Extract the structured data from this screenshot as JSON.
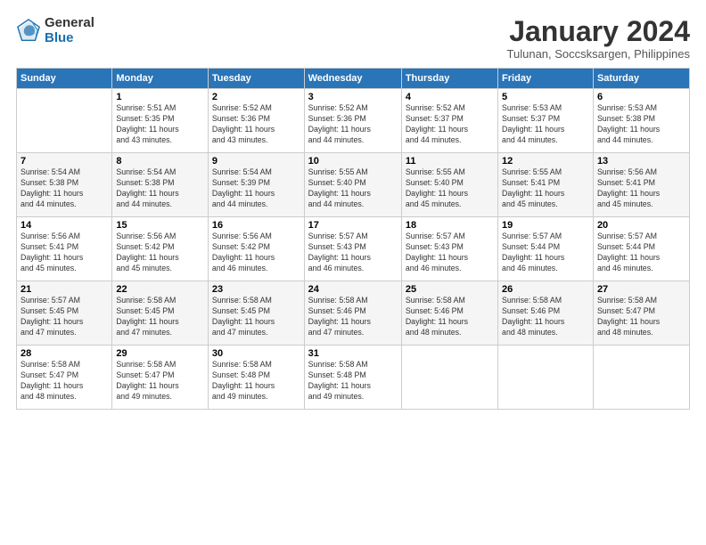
{
  "logo": {
    "general": "General",
    "blue": "Blue"
  },
  "title": {
    "main": "January 2024",
    "sub": "Tulunan, Soccsksargen, Philippines"
  },
  "calendar": {
    "headers": [
      "Sunday",
      "Monday",
      "Tuesday",
      "Wednesday",
      "Thursday",
      "Friday",
      "Saturday"
    ],
    "weeks": [
      [
        {
          "day": "",
          "info": ""
        },
        {
          "day": "1",
          "info": "Sunrise: 5:51 AM\nSunset: 5:35 PM\nDaylight: 11 hours\nand 43 minutes."
        },
        {
          "day": "2",
          "info": "Sunrise: 5:52 AM\nSunset: 5:36 PM\nDaylight: 11 hours\nand 43 minutes."
        },
        {
          "day": "3",
          "info": "Sunrise: 5:52 AM\nSunset: 5:36 PM\nDaylight: 11 hours\nand 44 minutes."
        },
        {
          "day": "4",
          "info": "Sunrise: 5:52 AM\nSunset: 5:37 PM\nDaylight: 11 hours\nand 44 minutes."
        },
        {
          "day": "5",
          "info": "Sunrise: 5:53 AM\nSunset: 5:37 PM\nDaylight: 11 hours\nand 44 minutes."
        },
        {
          "day": "6",
          "info": "Sunrise: 5:53 AM\nSunset: 5:38 PM\nDaylight: 11 hours\nand 44 minutes."
        }
      ],
      [
        {
          "day": "7",
          "info": "Sunrise: 5:54 AM\nSunset: 5:38 PM\nDaylight: 11 hours\nand 44 minutes."
        },
        {
          "day": "8",
          "info": "Sunrise: 5:54 AM\nSunset: 5:38 PM\nDaylight: 11 hours\nand 44 minutes."
        },
        {
          "day": "9",
          "info": "Sunrise: 5:54 AM\nSunset: 5:39 PM\nDaylight: 11 hours\nand 44 minutes."
        },
        {
          "day": "10",
          "info": "Sunrise: 5:55 AM\nSunset: 5:40 PM\nDaylight: 11 hours\nand 44 minutes."
        },
        {
          "day": "11",
          "info": "Sunrise: 5:55 AM\nSunset: 5:40 PM\nDaylight: 11 hours\nand 45 minutes."
        },
        {
          "day": "12",
          "info": "Sunrise: 5:55 AM\nSunset: 5:41 PM\nDaylight: 11 hours\nand 45 minutes."
        },
        {
          "day": "13",
          "info": "Sunrise: 5:56 AM\nSunset: 5:41 PM\nDaylight: 11 hours\nand 45 minutes."
        }
      ],
      [
        {
          "day": "14",
          "info": "Sunrise: 5:56 AM\nSunset: 5:41 PM\nDaylight: 11 hours\nand 45 minutes."
        },
        {
          "day": "15",
          "info": "Sunrise: 5:56 AM\nSunset: 5:42 PM\nDaylight: 11 hours\nand 45 minutes."
        },
        {
          "day": "16",
          "info": "Sunrise: 5:56 AM\nSunset: 5:42 PM\nDaylight: 11 hours\nand 46 minutes."
        },
        {
          "day": "17",
          "info": "Sunrise: 5:57 AM\nSunset: 5:43 PM\nDaylight: 11 hours\nand 46 minutes."
        },
        {
          "day": "18",
          "info": "Sunrise: 5:57 AM\nSunset: 5:43 PM\nDaylight: 11 hours\nand 46 minutes."
        },
        {
          "day": "19",
          "info": "Sunrise: 5:57 AM\nSunset: 5:44 PM\nDaylight: 11 hours\nand 46 minutes."
        },
        {
          "day": "20",
          "info": "Sunrise: 5:57 AM\nSunset: 5:44 PM\nDaylight: 11 hours\nand 46 minutes."
        }
      ],
      [
        {
          "day": "21",
          "info": "Sunrise: 5:57 AM\nSunset: 5:45 PM\nDaylight: 11 hours\nand 47 minutes."
        },
        {
          "day": "22",
          "info": "Sunrise: 5:58 AM\nSunset: 5:45 PM\nDaylight: 11 hours\nand 47 minutes."
        },
        {
          "day": "23",
          "info": "Sunrise: 5:58 AM\nSunset: 5:45 PM\nDaylight: 11 hours\nand 47 minutes."
        },
        {
          "day": "24",
          "info": "Sunrise: 5:58 AM\nSunset: 5:46 PM\nDaylight: 11 hours\nand 47 minutes."
        },
        {
          "day": "25",
          "info": "Sunrise: 5:58 AM\nSunset: 5:46 PM\nDaylight: 11 hours\nand 48 minutes."
        },
        {
          "day": "26",
          "info": "Sunrise: 5:58 AM\nSunset: 5:46 PM\nDaylight: 11 hours\nand 48 minutes."
        },
        {
          "day": "27",
          "info": "Sunrise: 5:58 AM\nSunset: 5:47 PM\nDaylight: 11 hours\nand 48 minutes."
        }
      ],
      [
        {
          "day": "28",
          "info": "Sunrise: 5:58 AM\nSunset: 5:47 PM\nDaylight: 11 hours\nand 48 minutes."
        },
        {
          "day": "29",
          "info": "Sunrise: 5:58 AM\nSunset: 5:47 PM\nDaylight: 11 hours\nand 49 minutes."
        },
        {
          "day": "30",
          "info": "Sunrise: 5:58 AM\nSunset: 5:48 PM\nDaylight: 11 hours\nand 49 minutes."
        },
        {
          "day": "31",
          "info": "Sunrise: 5:58 AM\nSunset: 5:48 PM\nDaylight: 11 hours\nand 49 minutes."
        },
        {
          "day": "",
          "info": ""
        },
        {
          "day": "",
          "info": ""
        },
        {
          "day": "",
          "info": ""
        }
      ]
    ]
  }
}
